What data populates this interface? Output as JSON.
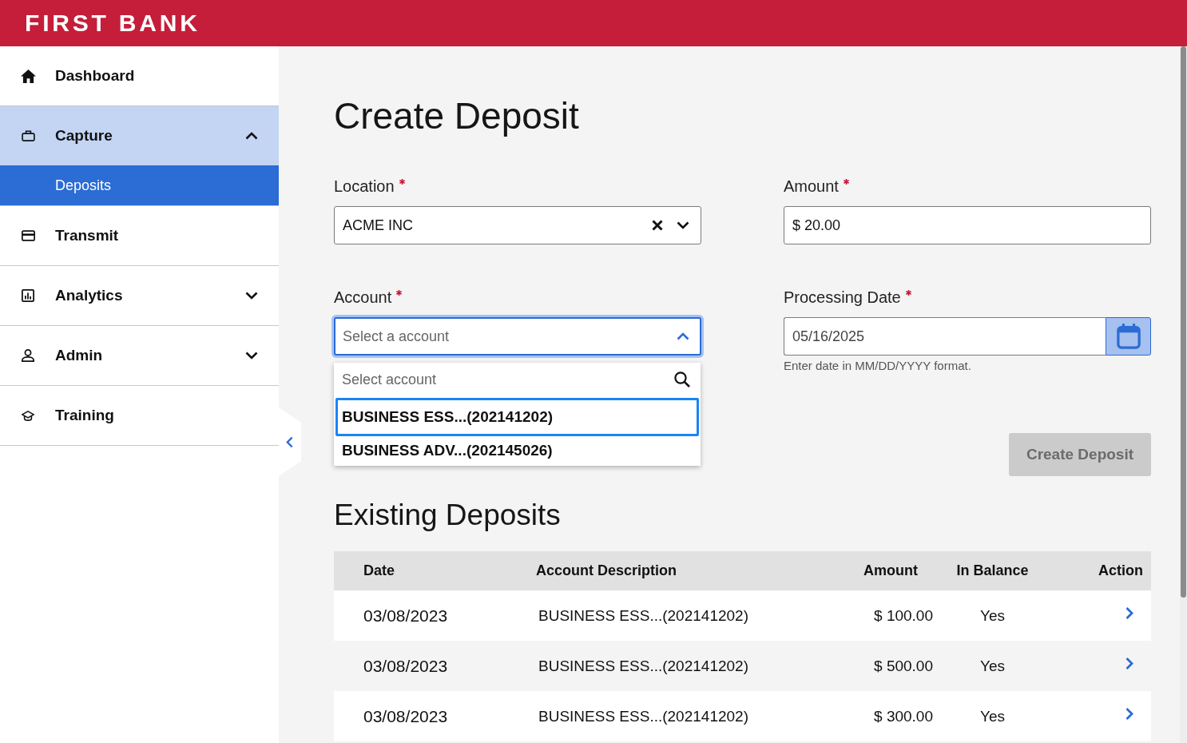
{
  "header": {
    "logo": "FIRST BANK"
  },
  "sidebar": {
    "items": [
      {
        "kind": "link",
        "label": "Dashboard",
        "selected": false
      },
      {
        "kind": "group",
        "label": "Capture",
        "selected": true,
        "expanded": true,
        "children": [
          {
            "label": "Deposits",
            "selected": true
          }
        ]
      },
      {
        "kind": "link",
        "label": "Transmit",
        "selected": false
      },
      {
        "kind": "group",
        "label": "Analytics",
        "selected": false,
        "expanded": false
      },
      {
        "kind": "group",
        "label": "Admin",
        "selected": false,
        "expanded": false
      },
      {
        "kind": "link",
        "label": "Training",
        "selected": false
      }
    ]
  },
  "page_title": "Create Deposit",
  "form": {
    "fields": [
      {
        "kind": "select",
        "label": "Location",
        "required": true,
        "value": "ACME INC",
        "expanded": false,
        "focused": false
      },
      {
        "kind": "text",
        "label": "Amount",
        "required": true,
        "value": "$ 20.00",
        "focused": false
      },
      {
        "kind": "select",
        "label": "Account",
        "required": true,
        "placeholder": "Select a account",
        "expanded": true,
        "focused": true,
        "dropdown": {
          "search": {
            "placeholder": "Select account"
          },
          "options": [
            {
              "label": "BUSINESS ESS...(202141202)",
              "selected": true
            },
            {
              "label": "BUSINESS ADV...(202145026)",
              "selected": false
            }
          ]
        }
      },
      {
        "kind": "date",
        "label": "Processing Date",
        "required": true,
        "value": "05/16/2025",
        "hint": "Enter date in MM/DD/YYYY format.",
        "focused": false
      }
    ],
    "submit": {
      "label": "Create Deposit",
      "disabled": true
    }
  },
  "existing_deposits": {
    "title": "Existing Deposits",
    "table": {
      "columns": [
        "Date",
        "Account Description",
        "Amount",
        "In Balance",
        "Action"
      ],
      "rows": [
        {
          "cells": [
            "03/08/2023",
            "BUSINESS ESS...(202141202)",
            "$ 100.00",
            "Yes"
          ]
        },
        {
          "cells": [
            "03/08/2023",
            "BUSINESS ESS...(202141202)",
            "$ 500.00",
            "Yes"
          ]
        },
        {
          "cells": [
            "03/08/2023",
            "BUSINESS ESS...(202141202)",
            "$ 300.00",
            "Yes"
          ]
        }
      ]
    }
  }
}
